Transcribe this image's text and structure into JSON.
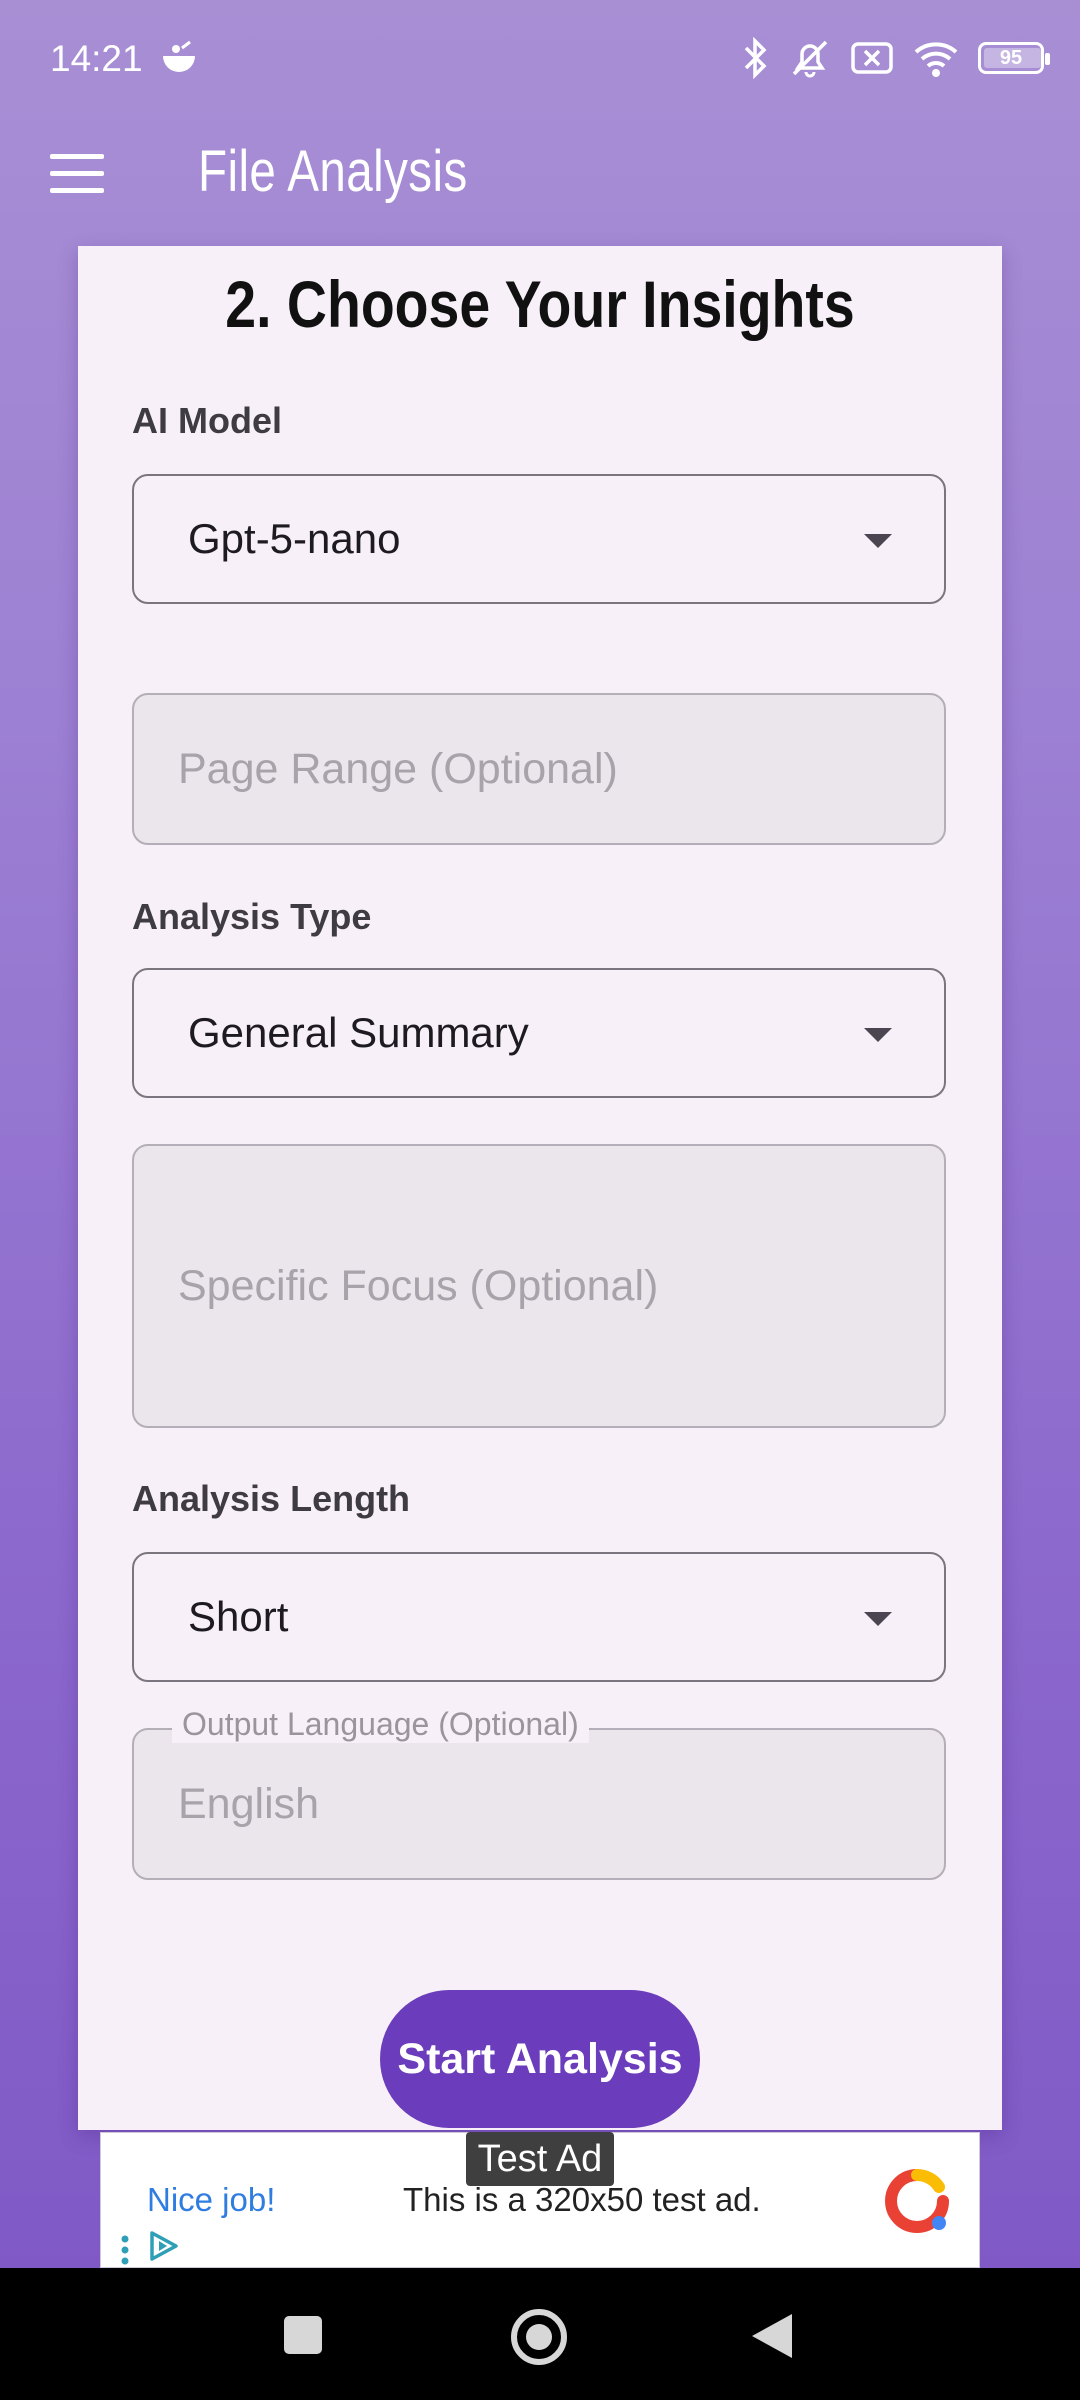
{
  "status_bar": {
    "time": "14:21",
    "battery_level": "95",
    "icons": [
      "bluetooth-icon",
      "mute-icon",
      "sim-disabled-icon",
      "wifi-icon",
      "battery-icon"
    ]
  },
  "app_bar": {
    "title": "File Analysis",
    "menu_icon": "hamburger-menu-icon"
  },
  "card": {
    "heading": "2. Choose Your Insights",
    "ai_model": {
      "label": "AI Model",
      "value": "Gpt-5-nano"
    },
    "page_range": {
      "placeholder": "Page Range (Optional)"
    },
    "analysis_type": {
      "label": "Analysis Type",
      "value": "General Summary"
    },
    "specific_focus": {
      "placeholder": "Specific Focus (Optional)"
    },
    "analysis_length": {
      "label": "Analysis Length",
      "value": "Short"
    },
    "output_language": {
      "label": "Output Language (Optional)",
      "value": "English"
    },
    "start_button": "Start Analysis"
  },
  "ad": {
    "tag": "Test Ad",
    "headline": "Nice job!",
    "body": "This is a 320x50 test ad."
  },
  "colors": {
    "primary": "#6b3cbb",
    "background_top": "#a88fd4",
    "background_bottom": "#7d56c4",
    "card": "#f7f0f8",
    "ad_link": "#2f7de1"
  }
}
